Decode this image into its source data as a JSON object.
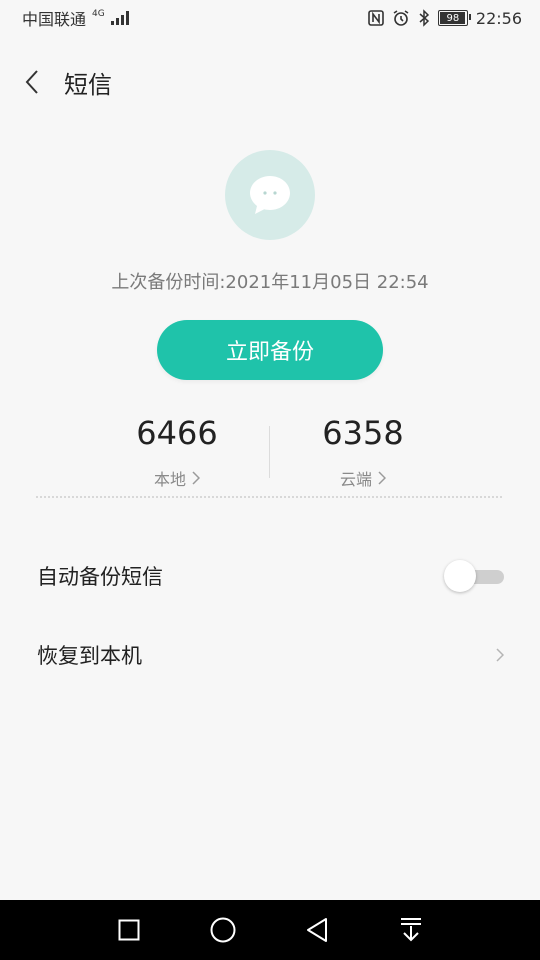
{
  "status_bar": {
    "carrier": "中国联通",
    "network": "4G",
    "battery": "98",
    "time": "22:56",
    "icons": [
      "nfc-icon",
      "alarm-icon",
      "bluetooth-icon",
      "battery-icon"
    ]
  },
  "header": {
    "title": "短信"
  },
  "backup": {
    "last_backup_label": "上次备份时间:2021年11月05日  22:54",
    "button_label": "立即备份"
  },
  "stats": {
    "local": {
      "count": "6466",
      "label": "本地"
    },
    "cloud": {
      "count": "6358",
      "label": "云端"
    }
  },
  "settings": {
    "auto_backup_label": "自动备份短信",
    "auto_backup_enabled": false,
    "restore_label": "恢复到本机"
  },
  "colors": {
    "accent": "#1fc3aa",
    "hero_bg": "#d6ebe8",
    "background": "#f7f7f7"
  },
  "nav": {
    "icons": [
      "recents-square-icon",
      "home-circle-icon",
      "back-triangle-icon",
      "notification-pull-icon"
    ]
  }
}
